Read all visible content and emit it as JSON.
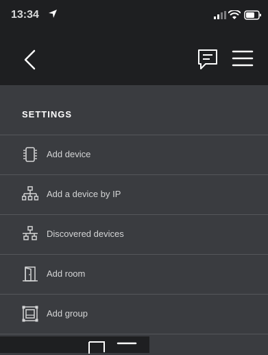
{
  "status_bar": {
    "time": "13:34",
    "icons": [
      "location-arrow-icon",
      "signal-icon",
      "wifi-icon",
      "battery-icon"
    ]
  },
  "nav": {
    "icons": [
      "back-chevron-icon",
      "chat-icon",
      "hamburger-menu-icon"
    ]
  },
  "settings": {
    "title": "SETTINGS",
    "items": [
      {
        "label": "Add device",
        "icon": "device-icon"
      },
      {
        "label": "Add a device by IP",
        "icon": "network-tree-icon"
      },
      {
        "label": "Discovered devices",
        "icon": "network-discovered-icon"
      },
      {
        "label": "Add room",
        "icon": "door-icon"
      },
      {
        "label": "Add group",
        "icon": "group-icon"
      }
    ]
  },
  "colors": {
    "status_nav_bg": "#1e1f21",
    "content_bg": "#3a3c40",
    "divider": "#55575b",
    "text": "#d4d5d6"
  }
}
